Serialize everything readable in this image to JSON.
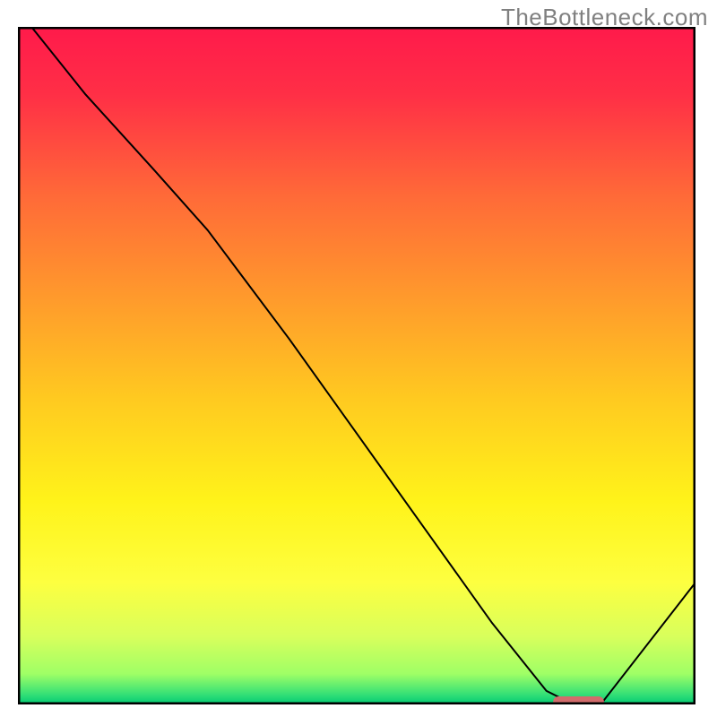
{
  "watermark": "TheBottleneck.com",
  "chart_data": {
    "type": "line",
    "title": "",
    "xlabel": "",
    "ylabel": "",
    "xlim": [
      0,
      100
    ],
    "ylim": [
      0,
      100
    ],
    "grid": false,
    "background": "rainbow-gradient",
    "series": [
      {
        "name": "curve",
        "x": [
          2,
          10,
          20,
          28,
          40,
          50,
          60,
          70,
          78,
          82,
          86,
          100
        ],
        "y": [
          100,
          90,
          79,
          70,
          54,
          40,
          26,
          12,
          2,
          0,
          0,
          18
        ],
        "color": "#000000",
        "linewidth": 2
      }
    ],
    "marker": {
      "shape": "rounded-bar",
      "x_start": 79,
      "x_end": 86.5,
      "y": 0.4,
      "color": "#d26c6c"
    },
    "frame_color": "#000000",
    "gradient_stops": [
      {
        "offset": 0.0,
        "color": "#ff1a4b"
      },
      {
        "offset": 0.1,
        "color": "#ff2f46"
      },
      {
        "offset": 0.25,
        "color": "#ff6a38"
      },
      {
        "offset": 0.4,
        "color": "#ff9a2c"
      },
      {
        "offset": 0.55,
        "color": "#ffca20"
      },
      {
        "offset": 0.7,
        "color": "#fff31a"
      },
      {
        "offset": 0.82,
        "color": "#fdff40"
      },
      {
        "offset": 0.9,
        "color": "#d8ff5c"
      },
      {
        "offset": 0.955,
        "color": "#9fff66"
      },
      {
        "offset": 0.985,
        "color": "#35e076"
      },
      {
        "offset": 1.0,
        "color": "#00c874"
      }
    ]
  }
}
